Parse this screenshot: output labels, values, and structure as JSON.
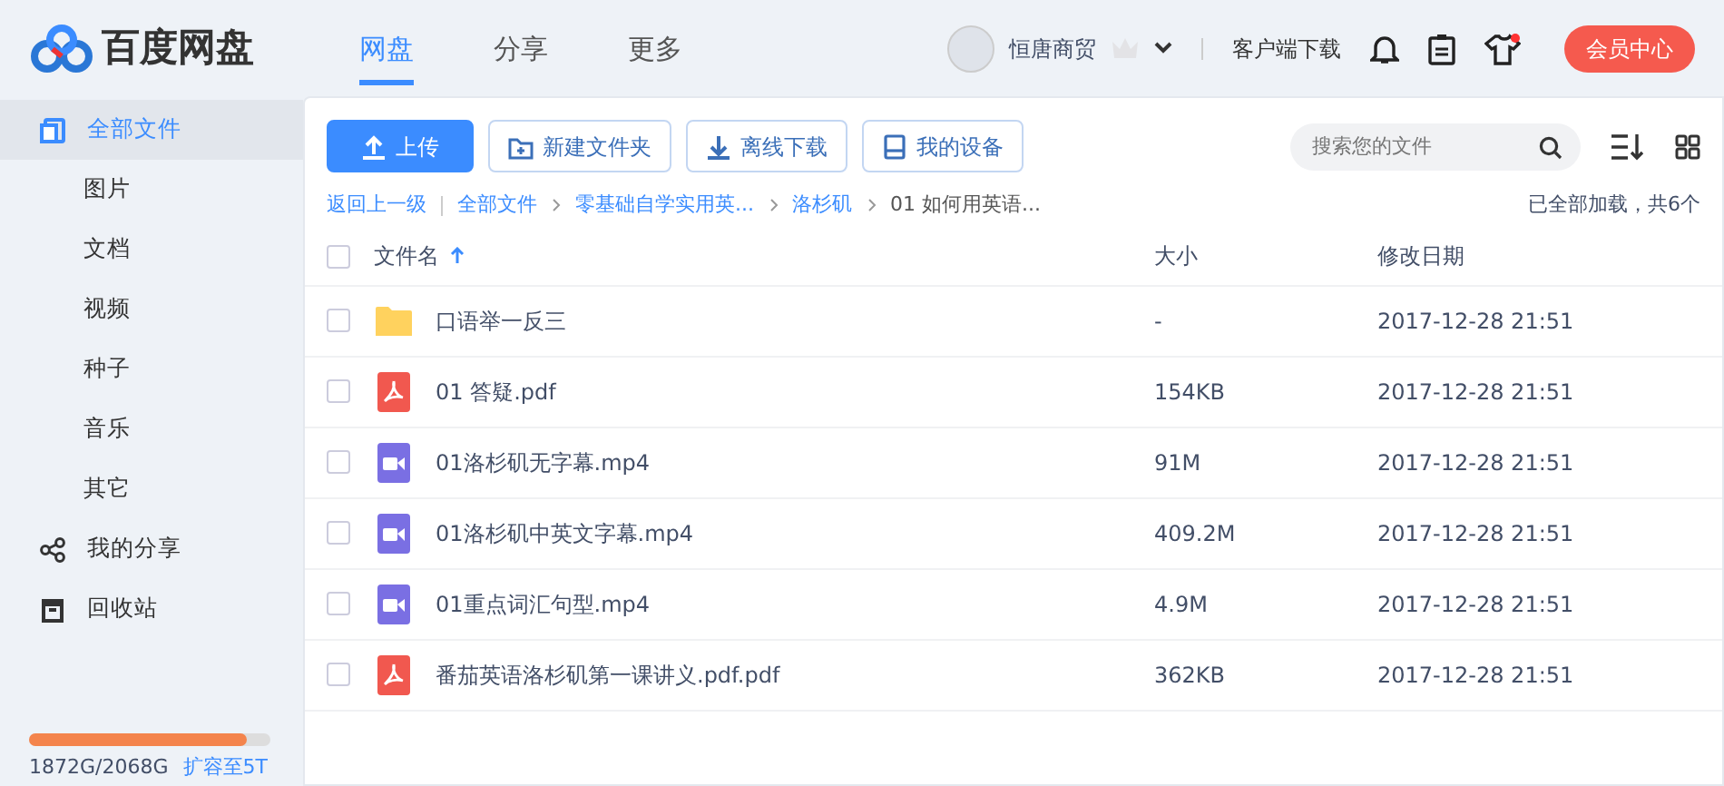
{
  "logo": {
    "text": "百度网盘"
  },
  "nav_tabs": [
    {
      "label": "网盘",
      "selected": true
    },
    {
      "label": "分享",
      "selected": false
    },
    {
      "label": "更多",
      "selected": false
    }
  ],
  "user": {
    "name": "恒唐商贸"
  },
  "header_links": [
    "客户端下载"
  ],
  "notifications": {
    "dot": true
  },
  "vip_button": "会员中心",
  "sidebar": {
    "items": [
      {
        "label": "全部文件",
        "selected": true,
        "children": [
          {
            "label": "图片",
            "selected": false
          },
          {
            "label": "文档",
            "selected": false
          },
          {
            "label": "视频",
            "selected": false
          },
          {
            "label": "种子",
            "selected": false
          },
          {
            "label": "音乐",
            "selected": false
          },
          {
            "label": "其它",
            "selected": false
          }
        ]
      },
      {
        "label": "我的分享",
        "selected": false
      },
      {
        "label": "回收站",
        "selected": false
      }
    ]
  },
  "storage": {
    "level": 0.905,
    "usage": "1872G/2068G",
    "upgrade": "扩容至5T"
  },
  "toolbar": [
    {
      "label": "上传",
      "kind": "primary"
    },
    {
      "label": "新建文件夹",
      "kind": "outline"
    },
    {
      "label": "离线下载",
      "kind": "outline"
    },
    {
      "label": "我的设备",
      "kind": "outline"
    }
  ],
  "search": {
    "placeholder": "搜索您的文件"
  },
  "breadcrumb": {
    "back": "返回上一级",
    "path": [
      "全部文件",
      "零基础自学实用英...",
      "洛杉矶",
      "01 如何用英语..."
    ]
  },
  "load_status": "已全部加载，共6个",
  "table": {
    "select_all_checked": false,
    "columns": [
      "文件名",
      "大小",
      "修改日期"
    ],
    "rows": [
      {
        "kind": "folder",
        "name": "口语举一反三",
        "size": "-",
        "date": "2017-12-28 21:51",
        "checked": false
      },
      {
        "kind": "pdf",
        "name": "01 答疑.pdf",
        "size": "154KB",
        "date": "2017-12-28 21:51",
        "checked": false
      },
      {
        "kind": "video",
        "name": "01洛杉矶无字幕.mp4",
        "size": "91M",
        "date": "2017-12-28 21:51",
        "checked": false
      },
      {
        "kind": "video",
        "name": "01洛杉矶中英文字幕.mp4",
        "size": "409.2M",
        "date": "2017-12-28 21:51",
        "checked": false
      },
      {
        "kind": "video",
        "name": "01重点词汇句型.mp4",
        "size": "4.9M",
        "date": "2017-12-28 21:51",
        "checked": false
      },
      {
        "kind": "pdf",
        "name": "番茄英语洛杉矶第一课讲义.pdf.pdf",
        "size": "362KB",
        "date": "2017-12-28 21:51",
        "checked": false
      }
    ]
  }
}
